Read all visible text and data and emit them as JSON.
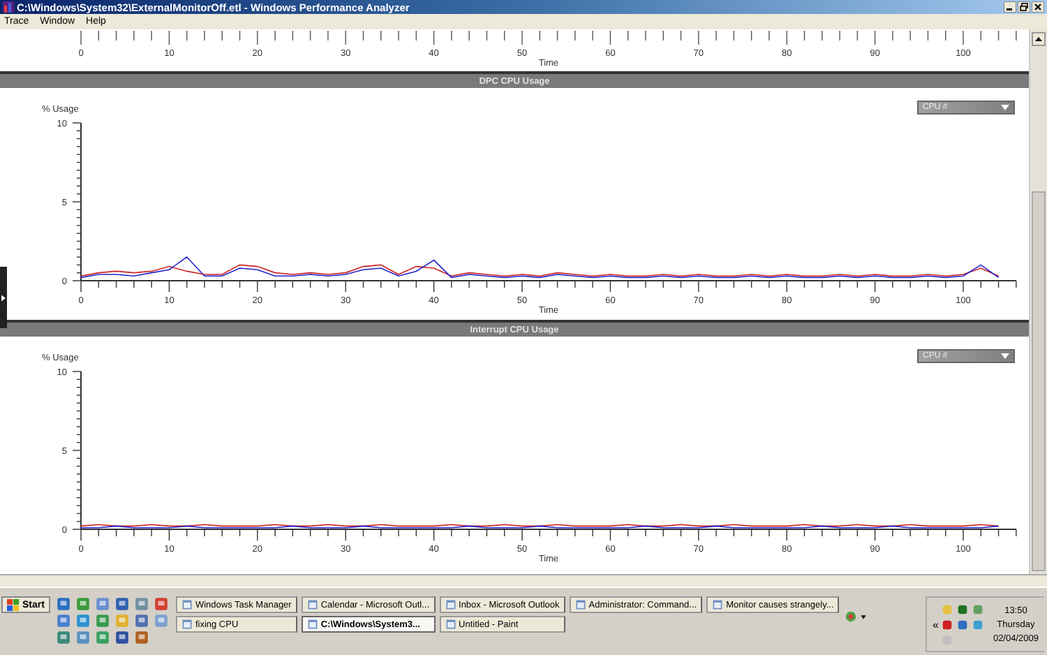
{
  "window": {
    "title": "C:\\Windows\\System32\\ExternalMonitorOff.etl - Windows Performance Analyzer"
  },
  "menu": [
    "Trace",
    "Window",
    "Help"
  ],
  "top_axis": {
    "ticks": [
      "0",
      "10",
      "20",
      "30",
      "40",
      "50",
      "60",
      "70",
      "80",
      "90",
      "100"
    ],
    "label": "Time"
  },
  "panels": [
    {
      "title": "DPC CPU Usage",
      "dropdown": "CPU #",
      "chart_data": {
        "type": "line",
        "xlabel": "Time",
        "ylabel": "% Usage",
        "xlim": [
          0,
          106
        ],
        "ylim": [
          0,
          10
        ],
        "xticks": [
          0,
          10,
          20,
          30,
          40,
          50,
          60,
          70,
          80,
          90,
          100
        ],
        "yticks": [
          0,
          5,
          10
        ],
        "x": [
          0,
          2,
          4,
          6,
          8,
          10,
          12,
          14,
          16,
          18,
          20,
          22,
          24,
          26,
          28,
          30,
          32,
          34,
          36,
          38,
          40,
          42,
          44,
          46,
          48,
          50,
          52,
          54,
          56,
          58,
          60,
          62,
          64,
          66,
          68,
          70,
          72,
          74,
          76,
          78,
          80,
          82,
          84,
          86,
          88,
          90,
          92,
          94,
          96,
          98,
          100,
          102,
          104
        ],
        "series": [
          {
            "color": "#cc2222",
            "values": [
              0.3,
              0.5,
              0.6,
              0.5,
              0.6,
              0.9,
              0.6,
              0.4,
              0.4,
              1.0,
              0.9,
              0.5,
              0.4,
              0.5,
              0.4,
              0.5,
              0.9,
              1.0,
              0.4,
              0.9,
              0.8,
              0.3,
              0.5,
              0.4,
              0.3,
              0.4,
              0.3,
              0.5,
              0.4,
              0.3,
              0.4,
              0.3,
              0.3,
              0.4,
              0.3,
              0.4,
              0.3,
              0.3,
              0.4,
              0.3,
              0.4,
              0.3,
              0.3,
              0.4,
              0.3,
              0.4,
              0.3,
              0.3,
              0.4,
              0.3,
              0.4,
              0.8,
              0.3
            ]
          },
          {
            "color": "#2222cc",
            "values": [
              0.2,
              0.4,
              0.4,
              0.3,
              0.5,
              0.7,
              1.5,
              0.3,
              0.3,
              0.8,
              0.7,
              0.3,
              0.3,
              0.4,
              0.3,
              0.4,
              0.7,
              0.8,
              0.3,
              0.6,
              1.3,
              0.2,
              0.4,
              0.3,
              0.2,
              0.3,
              0.2,
              0.4,
              0.3,
              0.2,
              0.3,
              0.2,
              0.2,
              0.3,
              0.2,
              0.3,
              0.2,
              0.2,
              0.3,
              0.2,
              0.3,
              0.2,
              0.2,
              0.3,
              0.2,
              0.3,
              0.2,
              0.2,
              0.3,
              0.2,
              0.3,
              1.0,
              0.2
            ]
          }
        ]
      }
    },
    {
      "title": "Interrupt CPU Usage",
      "dropdown": "CPU #",
      "chart_data": {
        "type": "line",
        "xlabel": "Time",
        "ylabel": "% Usage",
        "xlim": [
          0,
          106
        ],
        "ylim": [
          0,
          10
        ],
        "xticks": [
          0,
          10,
          20,
          30,
          40,
          50,
          60,
          70,
          80,
          90,
          100
        ],
        "yticks": [
          0,
          5,
          10
        ],
        "x": [
          0,
          2,
          4,
          6,
          8,
          10,
          12,
          14,
          16,
          18,
          20,
          22,
          24,
          26,
          28,
          30,
          32,
          34,
          36,
          38,
          40,
          42,
          44,
          46,
          48,
          50,
          52,
          54,
          56,
          58,
          60,
          62,
          64,
          66,
          68,
          70,
          72,
          74,
          76,
          78,
          80,
          82,
          84,
          86,
          88,
          90,
          92,
          94,
          96,
          98,
          100,
          102,
          104
        ],
        "series": [
          {
            "color": "#cc2222",
            "values": [
              0.2,
              0.3,
              0.2,
              0.2,
              0.3,
              0.2,
              0.2,
              0.3,
              0.2,
              0.2,
              0.2,
              0.3,
              0.2,
              0.2,
              0.3,
              0.2,
              0.2,
              0.3,
              0.2,
              0.2,
              0.2,
              0.3,
              0.2,
              0.2,
              0.3,
              0.2,
              0.2,
              0.3,
              0.2,
              0.2,
              0.2,
              0.3,
              0.2,
              0.2,
              0.3,
              0.2,
              0.2,
              0.3,
              0.2,
              0.2,
              0.2,
              0.3,
              0.2,
              0.2,
              0.3,
              0.2,
              0.2,
              0.3,
              0.2,
              0.2,
              0.2,
              0.3,
              0.2
            ]
          },
          {
            "color": "#2222cc",
            "values": [
              0.1,
              0.1,
              0.2,
              0.1,
              0.1,
              0.1,
              0.2,
              0.1,
              0.1,
              0.1,
              0.1,
              0.1,
              0.2,
              0.1,
              0.1,
              0.1,
              0.2,
              0.1,
              0.1,
              0.1,
              0.1,
              0.1,
              0.2,
              0.1,
              0.1,
              0.1,
              0.2,
              0.1,
              0.1,
              0.1,
              0.1,
              0.1,
              0.2,
              0.1,
              0.1,
              0.1,
              0.2,
              0.1,
              0.1,
              0.1,
              0.1,
              0.1,
              0.2,
              0.1,
              0.1,
              0.1,
              0.2,
              0.1,
              0.1,
              0.1,
              0.1,
              0.1,
              0.2
            ]
          }
        ]
      }
    }
  ],
  "taskbar": {
    "start": "Start",
    "tasks": [
      {
        "label": "Windows Task Manager",
        "selected": false
      },
      {
        "label": "Calendar - Microsoft Outl...",
        "selected": false
      },
      {
        "label": "Inbox - Microsoft Outlook",
        "selected": false
      },
      {
        "label": "Administrator: Command...",
        "selected": false
      },
      {
        "label": "Monitor causes strangely...",
        "selected": false
      },
      {
        "label": "fixing CPU",
        "selected": false
      },
      {
        "label": "C:\\Windows\\System3...",
        "selected": true
      },
      {
        "label": "Untitled - Paint",
        "selected": false
      }
    ],
    "tray": {
      "chevron": "«",
      "time": "13:50",
      "day": "Thursday",
      "date": "02/04/2009"
    }
  }
}
